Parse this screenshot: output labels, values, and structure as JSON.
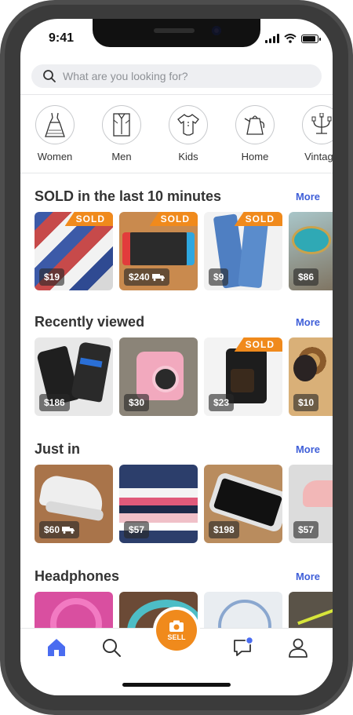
{
  "status": {
    "time": "9:41"
  },
  "search": {
    "placeholder": "What are you looking for?"
  },
  "categories": [
    {
      "label": "Women",
      "icon": "dress-icon"
    },
    {
      "label": "Men",
      "icon": "shirt-icon"
    },
    {
      "label": "Kids",
      "icon": "onesie-icon"
    },
    {
      "label": "Home",
      "icon": "kettle-icon"
    },
    {
      "label": "Vintage",
      "icon": "candelabra-icon"
    }
  ],
  "sections": [
    {
      "title": "SOLD in the last 10 minutes",
      "more": "More",
      "items": [
        {
          "price": "$19",
          "sold": "SOLD",
          "shipping": false
        },
        {
          "price": "$240",
          "sold": "SOLD",
          "shipping": true
        },
        {
          "price": "$9",
          "sold": "SOLD",
          "shipping": false
        },
        {
          "price": "$86",
          "sold": "",
          "shipping": false
        }
      ]
    },
    {
      "title": "Recently viewed",
      "more": "More",
      "items": [
        {
          "price": "$186",
          "sold": "",
          "shipping": false
        },
        {
          "price": "$30",
          "sold": "",
          "shipping": false
        },
        {
          "price": "$23",
          "sold": "SOLD",
          "shipping": false
        },
        {
          "price": "$10",
          "sold": "",
          "shipping": false
        }
      ]
    },
    {
      "title": "Just in",
      "more": "More",
      "items": [
        {
          "price": "$60",
          "sold": "",
          "shipping": true
        },
        {
          "price": "$57",
          "sold": "",
          "shipping": false
        },
        {
          "price": "$198",
          "sold": "",
          "shipping": false
        },
        {
          "price": "$57",
          "sold": "",
          "shipping": false
        }
      ]
    },
    {
      "title": "Headphones",
      "more": "More",
      "items": [
        {
          "price": "",
          "sold": "",
          "shipping": false
        },
        {
          "price": "",
          "sold": "",
          "shipping": false
        },
        {
          "price": "",
          "sold": "",
          "shipping": false
        },
        {
          "price": "",
          "sold": "",
          "shipping": false
        }
      ]
    }
  ],
  "tabbar": {
    "sell_label": "SELL",
    "accent": "#f08a1c",
    "active": "#4a6cf0"
  },
  "colors": {
    "more_link": "#3f5fd8",
    "sold_badge": "#f08a1c"
  }
}
